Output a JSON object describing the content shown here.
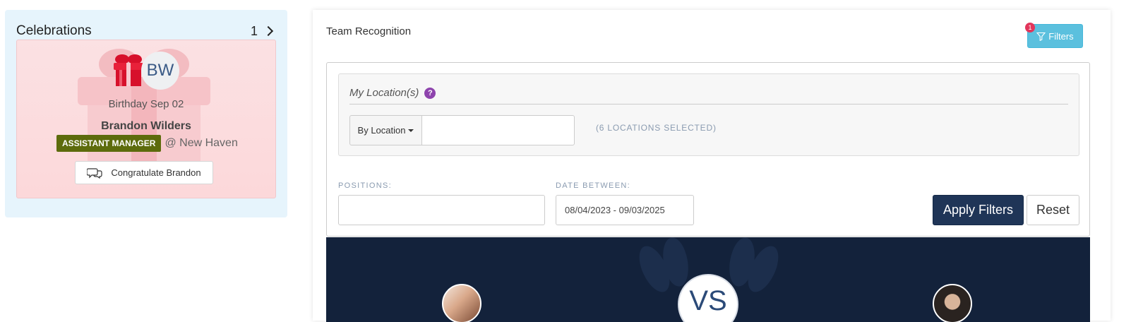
{
  "celebrations": {
    "title": "Celebrations",
    "count": "1",
    "card": {
      "initials": "BW",
      "event": "Birthday Sep 02",
      "name": "Brandon Wilders",
      "role": "ASSISTANT MANAGER",
      "location": "@ New Haven",
      "congratulate_label": "Congratulate Brandon"
    }
  },
  "team_recognition": {
    "title": "Team Recognition",
    "filters_button": {
      "label": "Filters",
      "badge": "1"
    },
    "location_filter": {
      "label": "My Location(s)",
      "help_glyph": "?",
      "mode_select": "By Location",
      "search_value": "",
      "selected_text": "(6 LOCATIONS SELECTED)"
    },
    "positions": {
      "label": "POSITIONS:",
      "value": ""
    },
    "date_between": {
      "label": "DATE BETWEEN:",
      "value": "08/04/2023 - 09/03/2025"
    },
    "apply_label": "Apply Filters",
    "reset_label": "Reset",
    "versus_text": "VS"
  },
  "colors": {
    "celebrations_bg": "#e6f4fc",
    "role_badge": "#5d6b0c",
    "filters_button": "#5bc0de",
    "apply_button": "#1f3557",
    "hero_bg": "#13223b",
    "help_icon": "#8e44ad"
  },
  "icons": [
    "chevron-right-icon",
    "gift-icon",
    "chat-bubbles-icon",
    "filter-icon",
    "help-icon",
    "caret-down-icon"
  ]
}
